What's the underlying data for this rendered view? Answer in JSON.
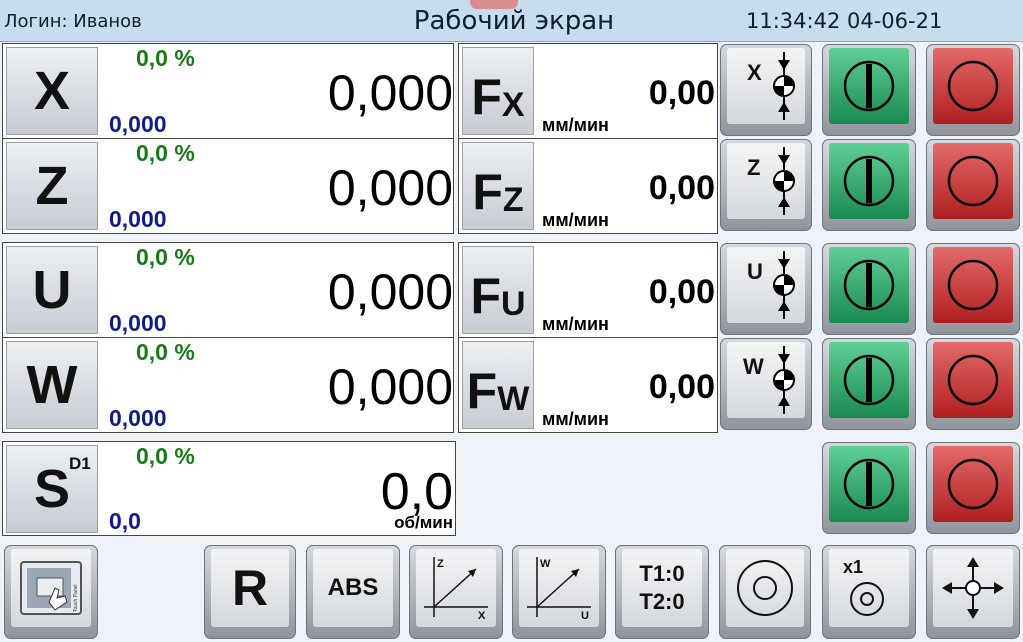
{
  "header": {
    "login": "Логин: Иванов",
    "title": "Рабочий экран",
    "datetime": "11:34:42 04-06-21",
    "colors": {
      "bar": "#c9dbef",
      "text": "#0e1e33"
    }
  },
  "axes": [
    {
      "label": "X",
      "percent": "0,0 %",
      "secondary": "0,000",
      "value": "0,000"
    },
    {
      "label": "Z",
      "percent": "0,0 %",
      "secondary": "0,000",
      "value": "0,000"
    },
    {
      "label": "U",
      "percent": "0,0 %",
      "secondary": "0,000",
      "value": "0,000"
    },
    {
      "label": "W",
      "percent": "0,0 %",
      "secondary": "0,000",
      "value": "0,000"
    }
  ],
  "feeds": [
    {
      "letter": "F",
      "sub": "X",
      "value": "0,00",
      "unit": "мм/мин"
    },
    {
      "letter": "F",
      "sub": "Z",
      "value": "0,00",
      "unit": "мм/мин"
    },
    {
      "letter": "F",
      "sub": "U",
      "value": "0,00",
      "unit": "мм/мин"
    },
    {
      "letter": "F",
      "sub": "W",
      "value": "0,00",
      "unit": "мм/мин"
    }
  ],
  "zero_buttons": [
    "X",
    "Z",
    "U",
    "W"
  ],
  "spindle": {
    "label": "S",
    "sup": "D1",
    "percent": "0,0 %",
    "secondary": "0,0",
    "value": "0,0",
    "unit": "об/мин"
  },
  "status_colors": {
    "green": "#1b8a50",
    "red": "#b01f1f",
    "percent": "#1a7a1a",
    "secondary": "#101d86"
  },
  "toolbar": {
    "touch_panel_caption": "Touch Panel",
    "r_label": "R",
    "abs_label": "ABS",
    "plane_xz": {
      "top": "Z",
      "bottom": "X"
    },
    "plane_wu": {
      "top": "W",
      "bottom": "U"
    },
    "tool_line1": "T1:0",
    "tool_line2": "T2:0",
    "multiplier": "x1",
    "icons": [
      "touch-panel-icon",
      "plane-xz-icon",
      "plane-wu-icon",
      "circle-target-icon",
      "handwheel-icon",
      "jog-arrows-icon"
    ]
  }
}
